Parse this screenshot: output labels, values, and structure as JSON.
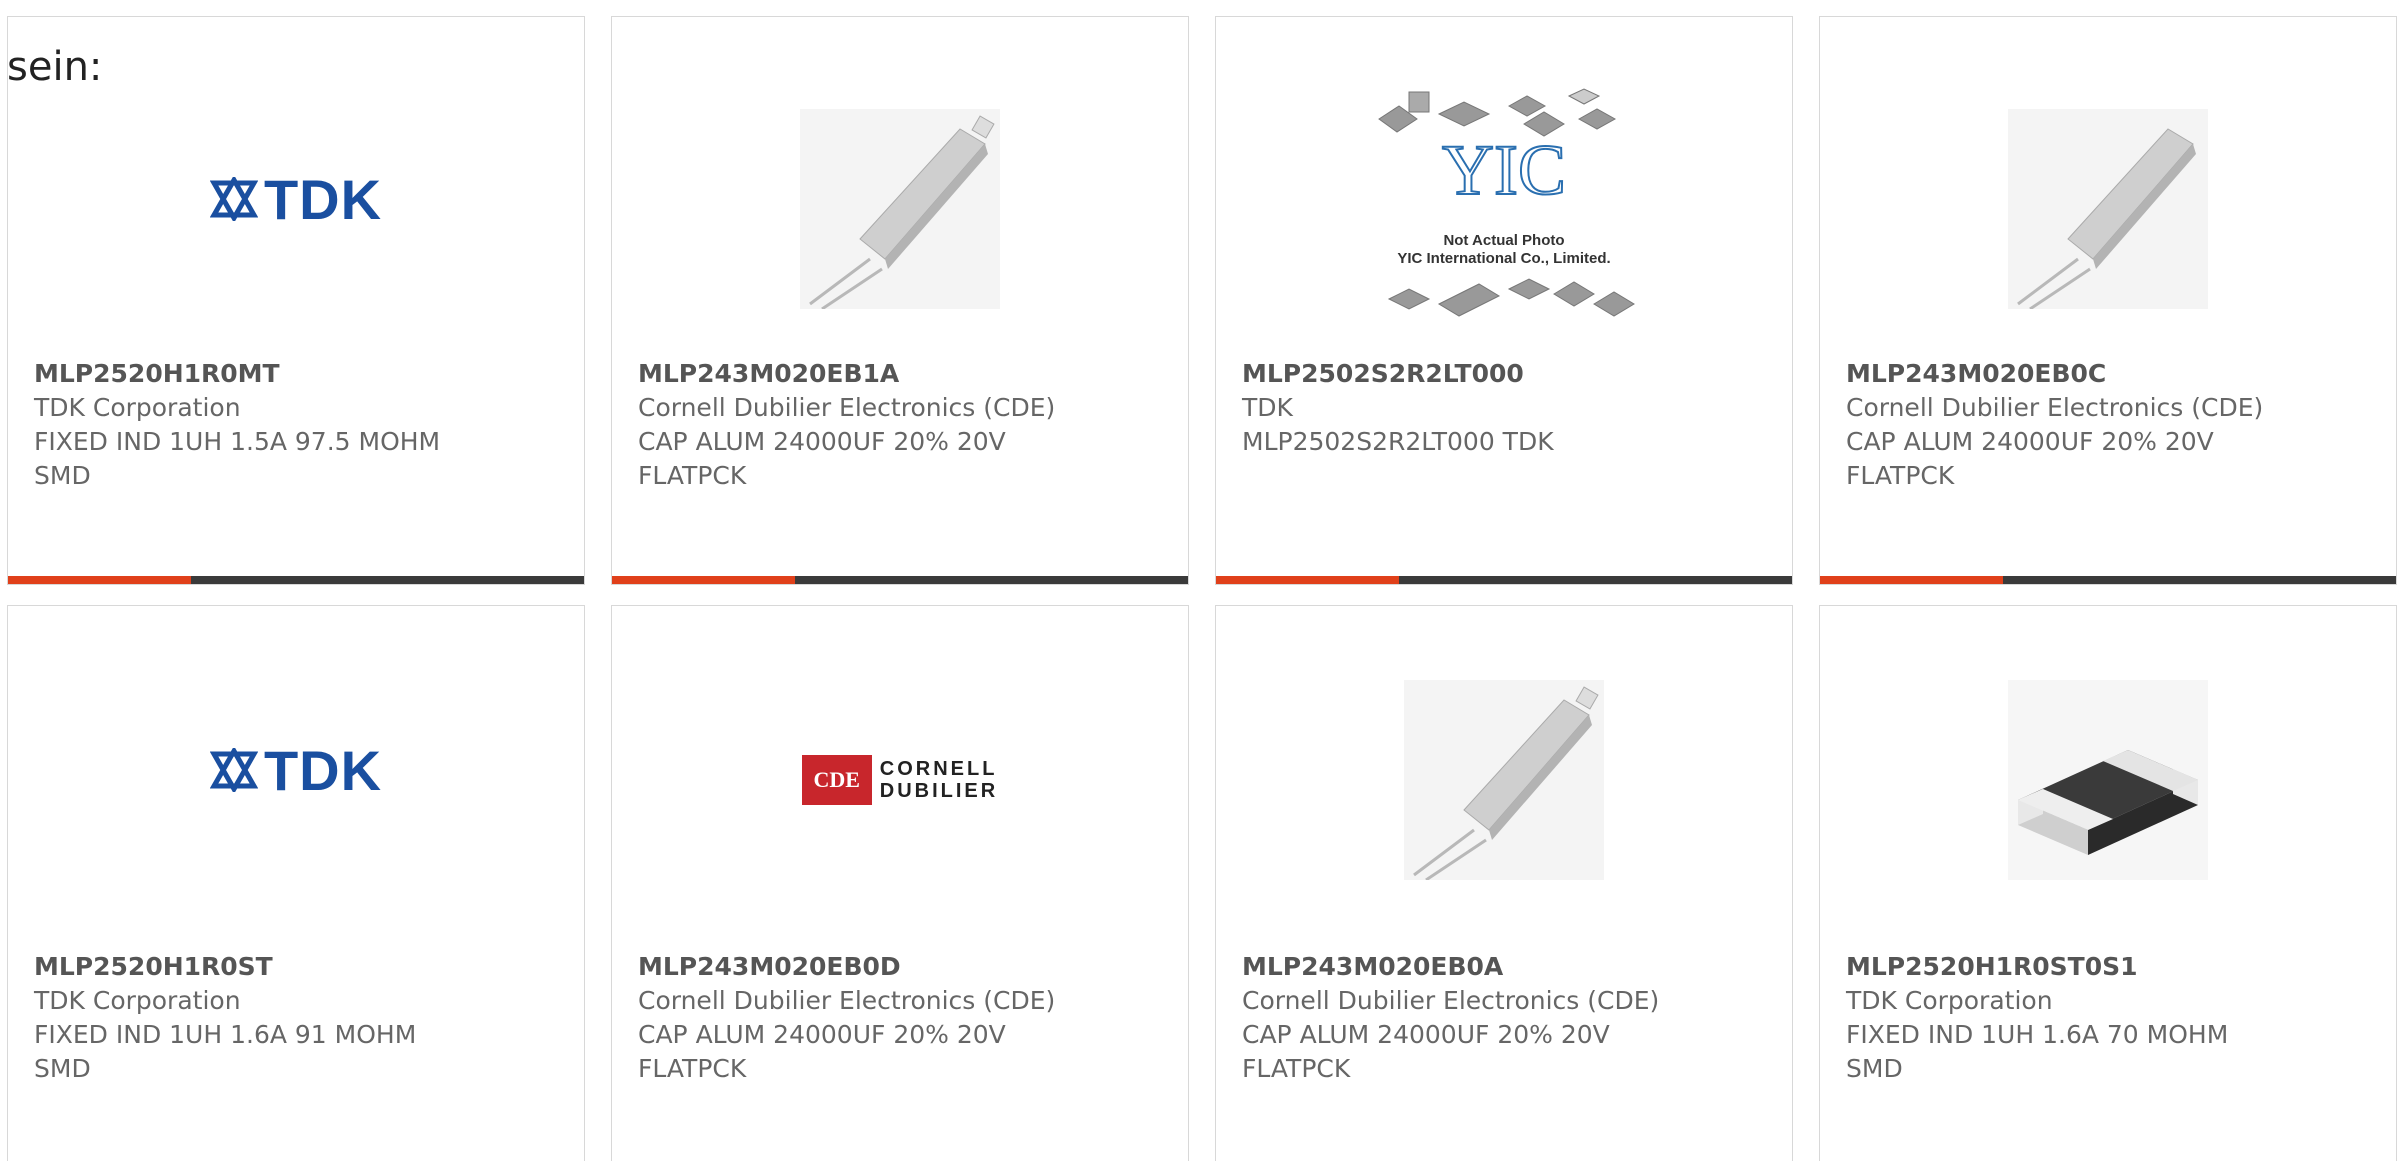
{
  "prefix_text": "sein:",
  "cards": [
    {
      "part": "MLP2520H1R0MT",
      "manufacturer": "TDK Corporation",
      "description": "FIXED IND 1UH 1.5A 97.5 MOHM\nSMD",
      "image": "tdk-logo",
      "logo_text": "TDK"
    },
    {
      "part": "MLP243M020EB1A",
      "manufacturer": "Cornell Dubilier Electronics (CDE)",
      "description": "CAP ALUM 24000UF 20% 20V\nFLATPCK",
      "image": "flatpack-capacitor"
    },
    {
      "part": "MLP2502S2R2LT000",
      "manufacturer": "TDK",
      "description": "MLP2502S2R2LT000 TDK",
      "image": "yic-placeholder",
      "logo_text": "YIC",
      "note_line1": "Not Actual Photo",
      "note_line2": "YIC International Co., Limited."
    },
    {
      "part": "MLP243M020EB0C",
      "manufacturer": "Cornell Dubilier Electronics (CDE)",
      "description": "CAP ALUM 24000UF 20% 20V\nFLATPCK",
      "image": "flatpack-capacitor"
    },
    {
      "part": "MLP2520H1R0ST",
      "manufacturer": "TDK Corporation",
      "description": "FIXED IND 1UH 1.6A 91 MOHM\nSMD",
      "image": "tdk-logo",
      "logo_text": "TDK"
    },
    {
      "part": "MLP243M020EB0D",
      "manufacturer": "Cornell Dubilier Electronics (CDE)",
      "description": "CAP ALUM 24000UF 20% 20V\nFLATPCK",
      "image": "cde-logo",
      "logo_mark": "CDE",
      "logo_line1": "CORNELL",
      "logo_line2": "DUBILIER"
    },
    {
      "part": "MLP243M020EB0A",
      "manufacturer": "Cornell Dubilier Electronics (CDE)",
      "description": "CAP ALUM 24000UF 20% 20V\nFLATPCK",
      "image": "flatpack-capacitor"
    },
    {
      "part": "MLP2520H1R0ST0S1",
      "manufacturer": "TDK Corporation",
      "description": "FIXED IND 1UH 1.6A 70 MOHM\nSMD",
      "image": "smd-inductor-chip"
    }
  ],
  "colors": {
    "accent": "#e0401a",
    "bar": "#3a3a3a",
    "tdk_blue": "#1a4fa0",
    "cde_red": "#c8262c"
  }
}
